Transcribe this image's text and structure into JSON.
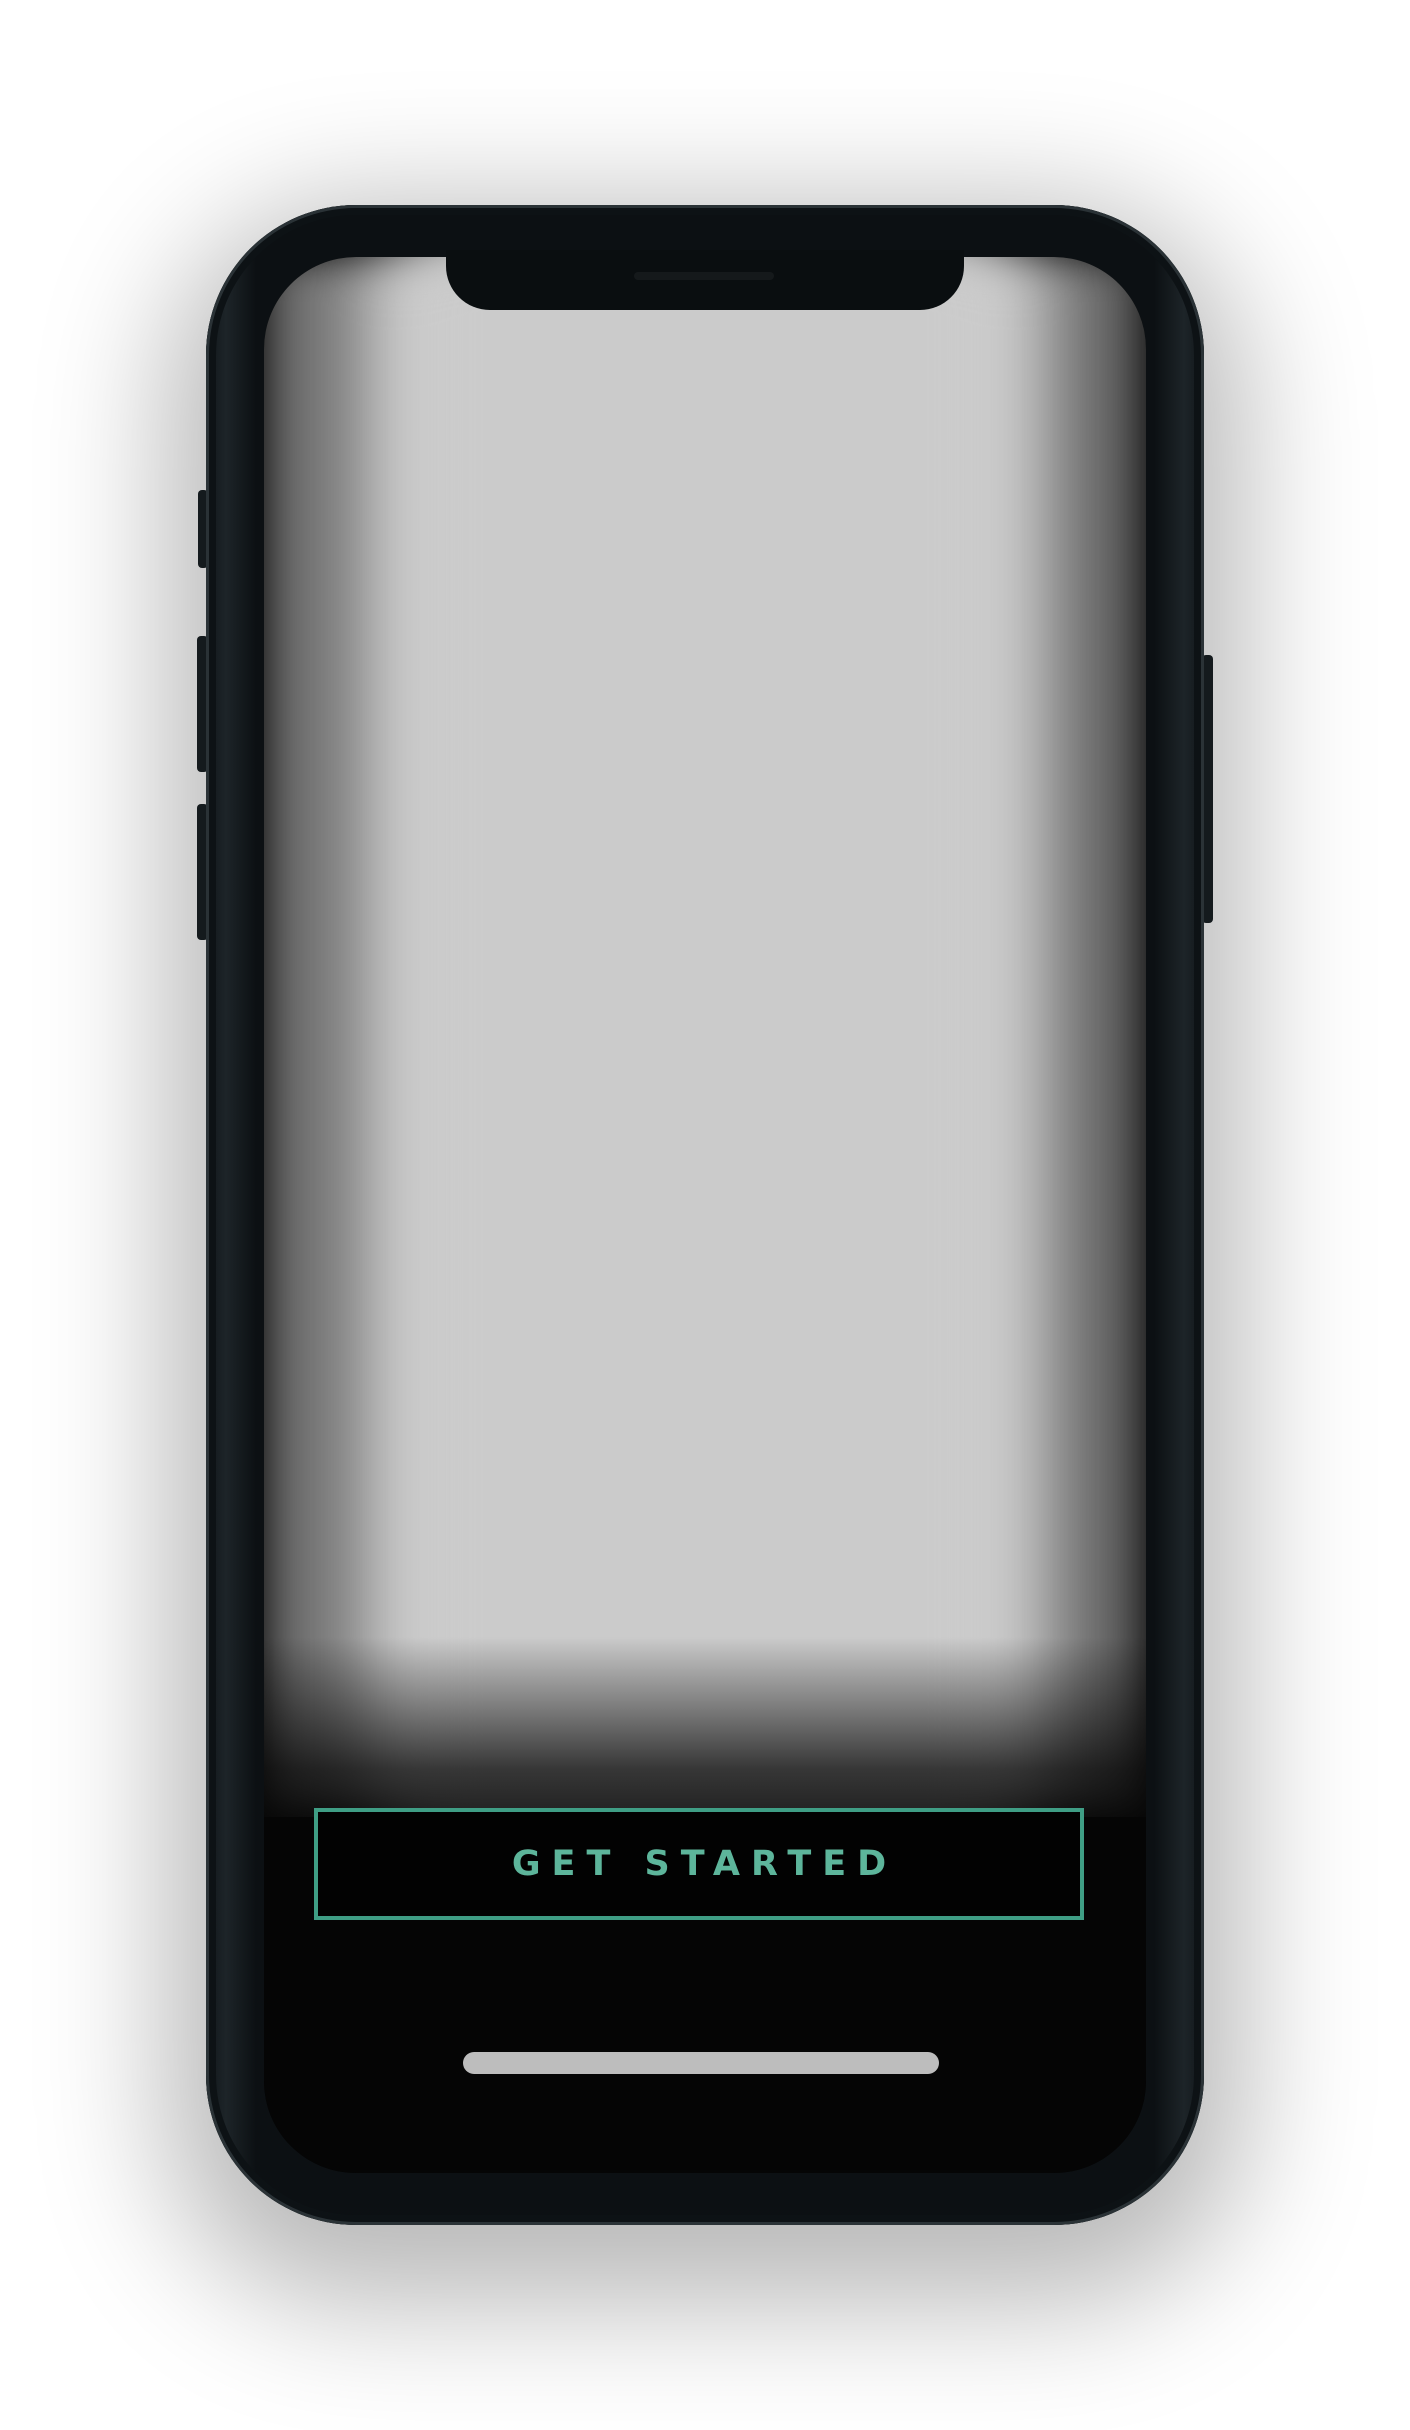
{
  "device": {
    "model": "phone",
    "frame_color": "#0c1013"
  },
  "screen": {
    "content_color": "#cbcbcb",
    "background_color": "#050505"
  },
  "cta": {
    "label": "GET STARTED",
    "accent_color": "#5db59b"
  },
  "home_indicator": {
    "color": "#bdbdbd"
  }
}
